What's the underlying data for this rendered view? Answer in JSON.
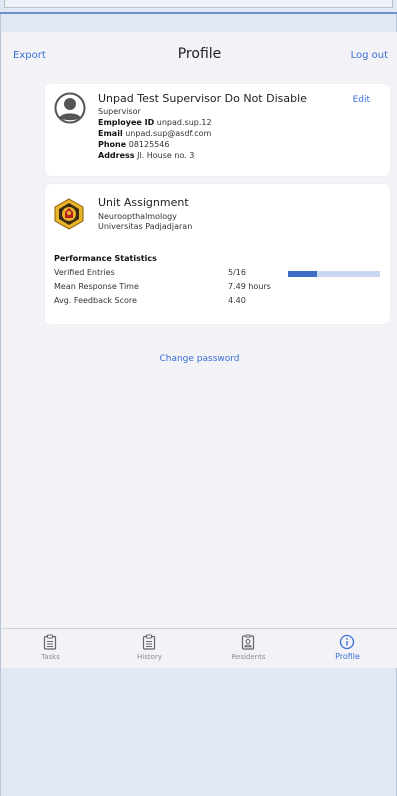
{
  "header": {
    "export_label": "Export",
    "title": "Profile",
    "logout_label": "Log out"
  },
  "profile": {
    "name": "Unpad Test Supervisor Do Not Disable",
    "role": "Supervisor",
    "edit_label": "Edit",
    "fields": [
      {
        "label": "Employee ID",
        "value": "unpad.sup.12"
      },
      {
        "label": "Email",
        "value": "unpad.sup@asdf.com"
      },
      {
        "label": "Phone",
        "value": "08125546"
      },
      {
        "label": "Address",
        "value": "Jl. House no. 3"
      }
    ]
  },
  "unit": {
    "title": "Unit Assignment",
    "department": "Neuroopthalmology",
    "institution": "Universitas Padjadjaran"
  },
  "stats": {
    "title": "Performance Statistics",
    "rows": [
      {
        "label": "Verified Entries",
        "value": "5/16",
        "progress": 0.3125
      },
      {
        "label": "Mean Response Time",
        "value": "7.49 hours"
      },
      {
        "label": "Avg. Feedback Score",
        "value": "4.40"
      }
    ]
  },
  "change_password_label": "Change password",
  "tabs": [
    {
      "label": "Tasks",
      "icon": "clipboard-icon",
      "active": false
    },
    {
      "label": "History",
      "icon": "clipboard-icon",
      "active": false
    },
    {
      "label": "Residents",
      "icon": "id-badge-icon",
      "active": false
    },
    {
      "label": "Profile",
      "icon": "info-icon",
      "active": true
    }
  ],
  "colors": {
    "accent": "#3a6fd6",
    "progress_fill": "#3c6dc7",
    "progress_track": "#c8d7ef",
    "background": "#dfe8f3"
  }
}
